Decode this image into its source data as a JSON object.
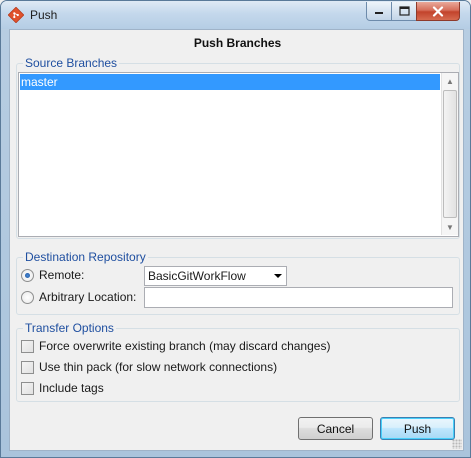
{
  "window": {
    "title": "Push",
    "icon": "git-icon",
    "minimize_glyph": "▁",
    "maximize_glyph": "□",
    "close_glyph": "✕"
  },
  "dialog": {
    "heading": "Push Branches"
  },
  "source_branches": {
    "group_label": "Source Branches",
    "items": [
      "master"
    ],
    "selected": "master"
  },
  "destination": {
    "group_label": "Destination Repository",
    "remote_label": "Remote:",
    "remote_selected": true,
    "remote_value": "BasicGitWorkFlow",
    "arbitrary_label": "Arbitrary Location:",
    "arbitrary_value": ""
  },
  "transfer": {
    "group_label": "Transfer Options",
    "options": [
      {
        "label": "Force overwrite existing branch (may discard changes)",
        "checked": false
      },
      {
        "label": "Use thin pack (for slow network connections)",
        "checked": false
      },
      {
        "label": "Include tags",
        "checked": false
      }
    ]
  },
  "buttons": {
    "cancel": "Cancel",
    "push": "Push"
  },
  "colors": {
    "group_label": "#1f4fa0",
    "selection": "#3399ff",
    "close_button": "#c2432c"
  }
}
